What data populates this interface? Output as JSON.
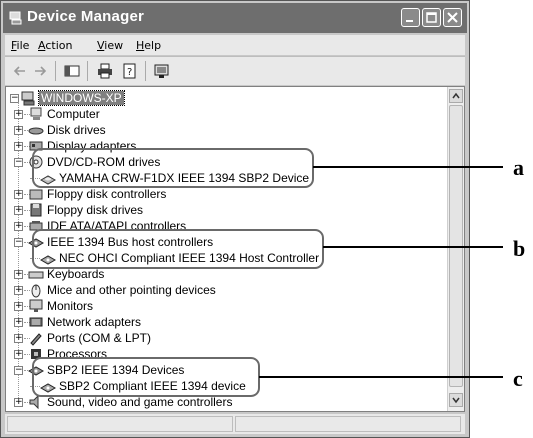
{
  "window": {
    "title": "Device Manager",
    "controls": [
      "minimize-icon",
      "maximize-icon",
      "close-icon"
    ]
  },
  "menu": {
    "file": "ile",
    "file_accel": "F",
    "action": "ction",
    "action_accel": "A",
    "view": "iew",
    "view_accel": "V",
    "help": "elp",
    "help_accel": "H"
  },
  "toolbar": {
    "icons": [
      "back-arrow-icon",
      "forward-arrow-icon",
      "properties-pane-icon",
      "print-icon",
      "help-page-icon",
      "scan-hardware-icon"
    ]
  },
  "tree": {
    "root": "WINDOWS-XP",
    "items": [
      {
        "label": "Computer",
        "icon": "computer-icon"
      },
      {
        "label": "Disk drives",
        "icon": "disk-drive-icon"
      },
      {
        "label": "Display adapters",
        "icon": "display-adapter-icon"
      },
      {
        "label": "DVD/CD-ROM drives",
        "icon": "cdrom-icon",
        "expanded": true
      },
      {
        "label": "YAMAHA CRW-F1DX IEEE 1394 SBP2 Device",
        "icon": "cdrom-device-icon",
        "child": true
      },
      {
        "label": "Floppy disk controllers",
        "icon": "floppy-controller-icon"
      },
      {
        "label": "Floppy disk drives",
        "icon": "floppy-icon"
      },
      {
        "label": "IDE ATA/ATAPI controllers",
        "icon": "ide-icon"
      },
      {
        "label": "IEEE 1394 Bus host controllers",
        "icon": "ieee1394-icon",
        "expanded": true
      },
      {
        "label": "NEC OHCI Compliant IEEE 1394 Host Controller",
        "icon": "ieee1394-device-icon",
        "child": true
      },
      {
        "label": "Keyboards",
        "icon": "keyboard-icon"
      },
      {
        "label": "Mice and other pointing devices",
        "icon": "mouse-icon"
      },
      {
        "label": "Monitors",
        "icon": "monitor-icon"
      },
      {
        "label": "Network adapters",
        "icon": "network-icon"
      },
      {
        "label": "Ports (COM & LPT)",
        "icon": "port-icon"
      },
      {
        "label": "Processors",
        "icon": "processor-icon"
      },
      {
        "label": "SBP2 IEEE 1394 Devices",
        "icon": "ieee1394-icon",
        "expanded": true
      },
      {
        "label": "SBP2 Compliant IEEE 1394 device",
        "icon": "ieee1394-device-icon",
        "child": true
      },
      {
        "label": "Sound, video and game controllers",
        "icon": "sound-icon"
      }
    ]
  },
  "callouts": {
    "a": "a",
    "b": "b",
    "c": "c"
  },
  "colors": {
    "titlebar": "#6e6e6e",
    "chrome": "#c8c8c8",
    "selection": "#808080"
  }
}
